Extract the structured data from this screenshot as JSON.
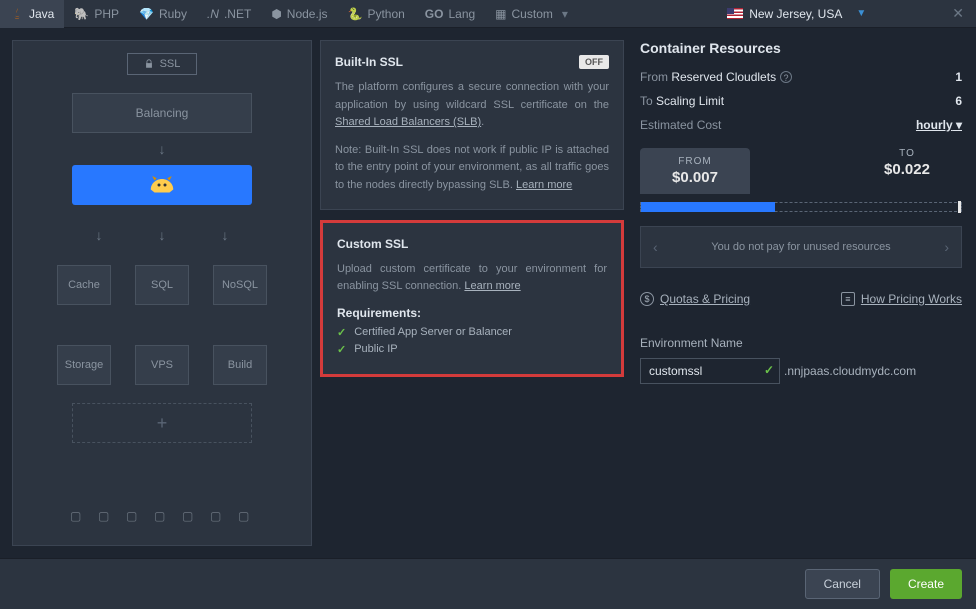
{
  "tabs": [
    {
      "label": "Java"
    },
    {
      "label": "PHP"
    },
    {
      "label": "Ruby"
    },
    {
      "label": ".NET"
    },
    {
      "label": "Node.js"
    },
    {
      "label": "Python"
    },
    {
      "label": "Lang"
    },
    {
      "label": "Custom"
    }
  ],
  "region": "New Jersey, USA",
  "col1": {
    "ssl_btn": "SSL",
    "balancing": "Balancing",
    "nodes_row1": [
      "Cache",
      "SQL",
      "NoSQL"
    ],
    "nodes_row2": [
      "Storage",
      "VPS",
      "Build"
    ]
  },
  "builtin": {
    "title": "Built-In SSL",
    "badge": "OFF",
    "p1a": "The platform configures a secure connection with your application by using wildcard SSL certificate on the ",
    "p1link": "Shared Load Balancers (SLB)",
    "p1b": ".",
    "p2a": "Note: Built-In SSL does not work if public IP is attached to the entry point of your environment, as all traffic goes to the nodes directly bypassing SLB. ",
    "p2link": "Learn more"
  },
  "custom": {
    "title": "Custom SSL",
    "p1a": "Upload custom certificate to your environment for enabling SSL connection. ",
    "p1link": "Learn more",
    "req_title": "Requirements:",
    "req1": "Certified App Server or Balancer",
    "req2": "Public IP"
  },
  "resources": {
    "title": "Container Resources",
    "row1_label_a": "From ",
    "row1_label_b": "Reserved Cloudlets",
    "row1_val": "1",
    "row2_label_a": "To ",
    "row2_label_b": "Scaling Limit",
    "row2_val": "6",
    "row3_label": "Estimated Cost",
    "row3_val": "hourly",
    "from_label": "FROM",
    "from_val": "$0.007",
    "to_label": "TO",
    "to_val": "$0.022",
    "carousel": "You do not pay for unused resources",
    "quotas": "Quotas & Pricing",
    "howworks": "How Pricing Works"
  },
  "env": {
    "label": "Environment Name",
    "value": "customssl",
    "domain": ".nnjpaas.cloudmydc.com"
  },
  "footer": {
    "cancel": "Cancel",
    "create": "Create"
  }
}
